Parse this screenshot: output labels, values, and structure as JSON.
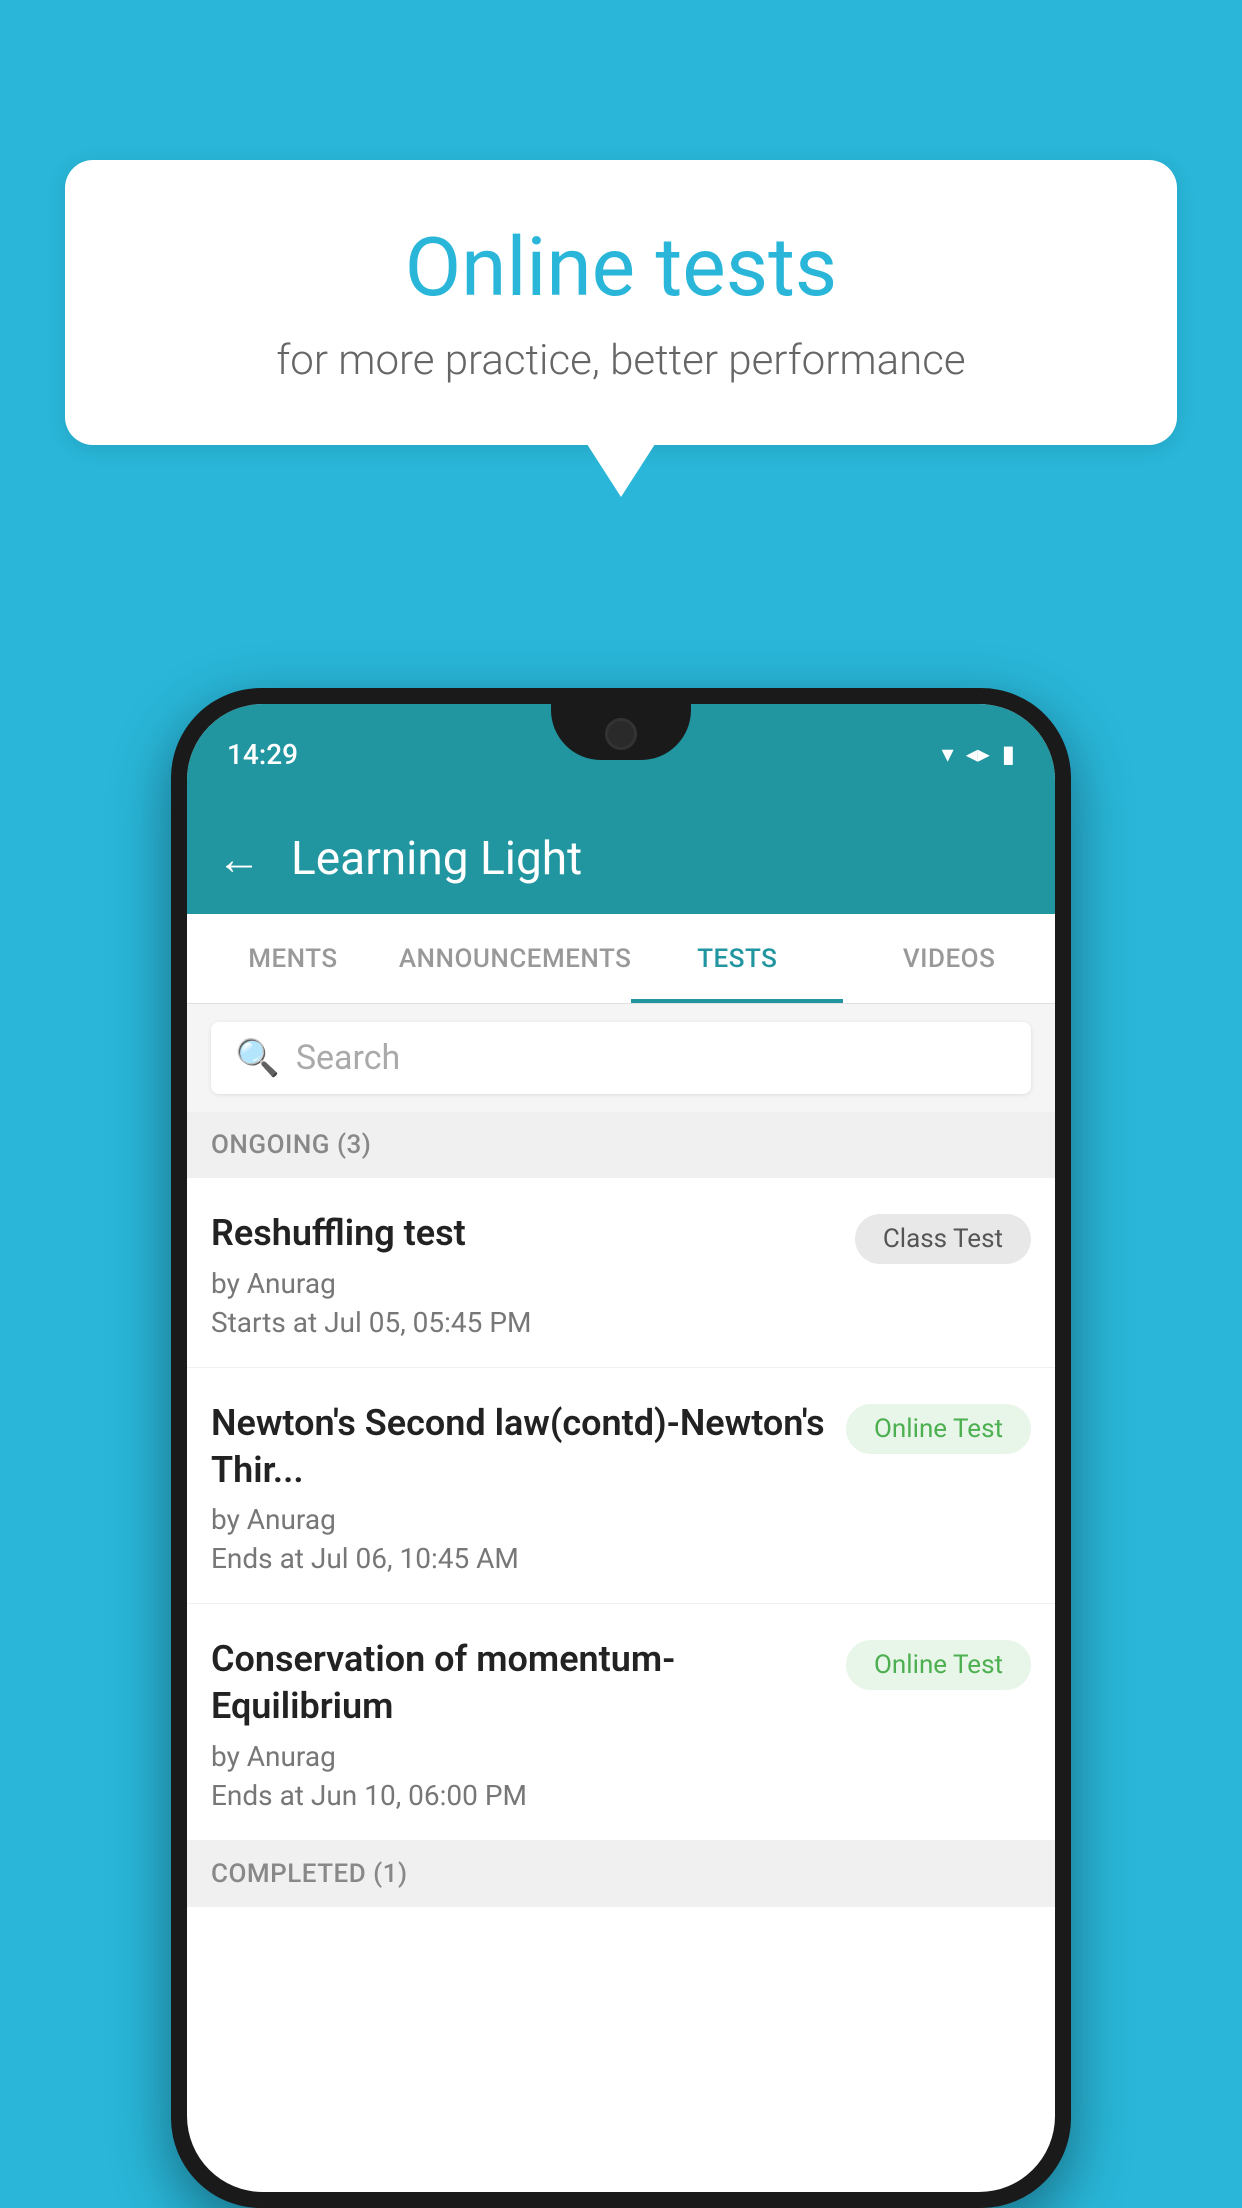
{
  "background_color": "#29b6d8",
  "speech_bubble": {
    "title": "Online tests",
    "subtitle": "for more practice, better performance"
  },
  "phone": {
    "status_bar": {
      "time": "14:29",
      "icons": [
        "wifi",
        "signal",
        "battery"
      ]
    },
    "app_bar": {
      "title": "Learning Light",
      "back_label": "←"
    },
    "tabs": [
      {
        "label": "MENTS",
        "active": false
      },
      {
        "label": "ANNOUNCEMENTS",
        "active": false
      },
      {
        "label": "TESTS",
        "active": true
      },
      {
        "label": "VIDEOS",
        "active": false
      }
    ],
    "search": {
      "placeholder": "Search"
    },
    "section_ongoing": {
      "label": "ONGOING (3)"
    },
    "tests_ongoing": [
      {
        "title": "Reshuffling test",
        "by": "by Anurag",
        "date_label": "Starts at",
        "date": "Jul 05, 05:45 PM",
        "badge": "Class Test",
        "badge_type": "class"
      },
      {
        "title": "Newton's Second law(contd)-Newton's Thir...",
        "by": "by Anurag",
        "date_label": "Ends at",
        "date": "Jul 06, 10:45 AM",
        "badge": "Online Test",
        "badge_type": "online"
      },
      {
        "title": "Conservation of momentum-Equilibrium",
        "by": "by Anurag",
        "date_label": "Ends at",
        "date": "Jun 10, 06:00 PM",
        "badge": "Online Test",
        "badge_type": "online"
      }
    ],
    "section_completed": {
      "label": "COMPLETED (1)"
    }
  }
}
